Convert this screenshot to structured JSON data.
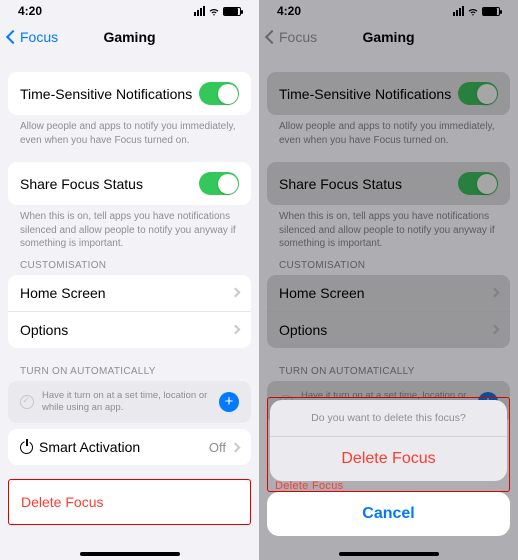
{
  "status": {
    "time": "4:20"
  },
  "nav": {
    "back": "Focus",
    "title": "Gaming"
  },
  "rows": {
    "timeSensitive": "Time-Sensitive Notifications",
    "shareStatus": "Share Focus Status",
    "homeScreen": "Home Screen",
    "options": "Options",
    "smartActivation": "Smart Activation",
    "smartValue": "Off"
  },
  "desc": {
    "timeSensitive": "Allow people and apps to notify you immediately, even when you have Focus turned on.",
    "shareStatus": "When this is on, tell apps you have notifications silenced and allow people to notify you anyway if something is important.",
    "autoHint": "Have it turn on at a set time, location or while using an app."
  },
  "headers": {
    "customisation": "CUSTOMISATION",
    "auto": "TURN ON AUTOMATICALLY"
  },
  "delete": "Delete Focus",
  "sheet": {
    "question": "Do you want to delete this focus?",
    "delete": "Delete Focus",
    "cancel": "Cancel",
    "peek": "Delete Focus"
  }
}
